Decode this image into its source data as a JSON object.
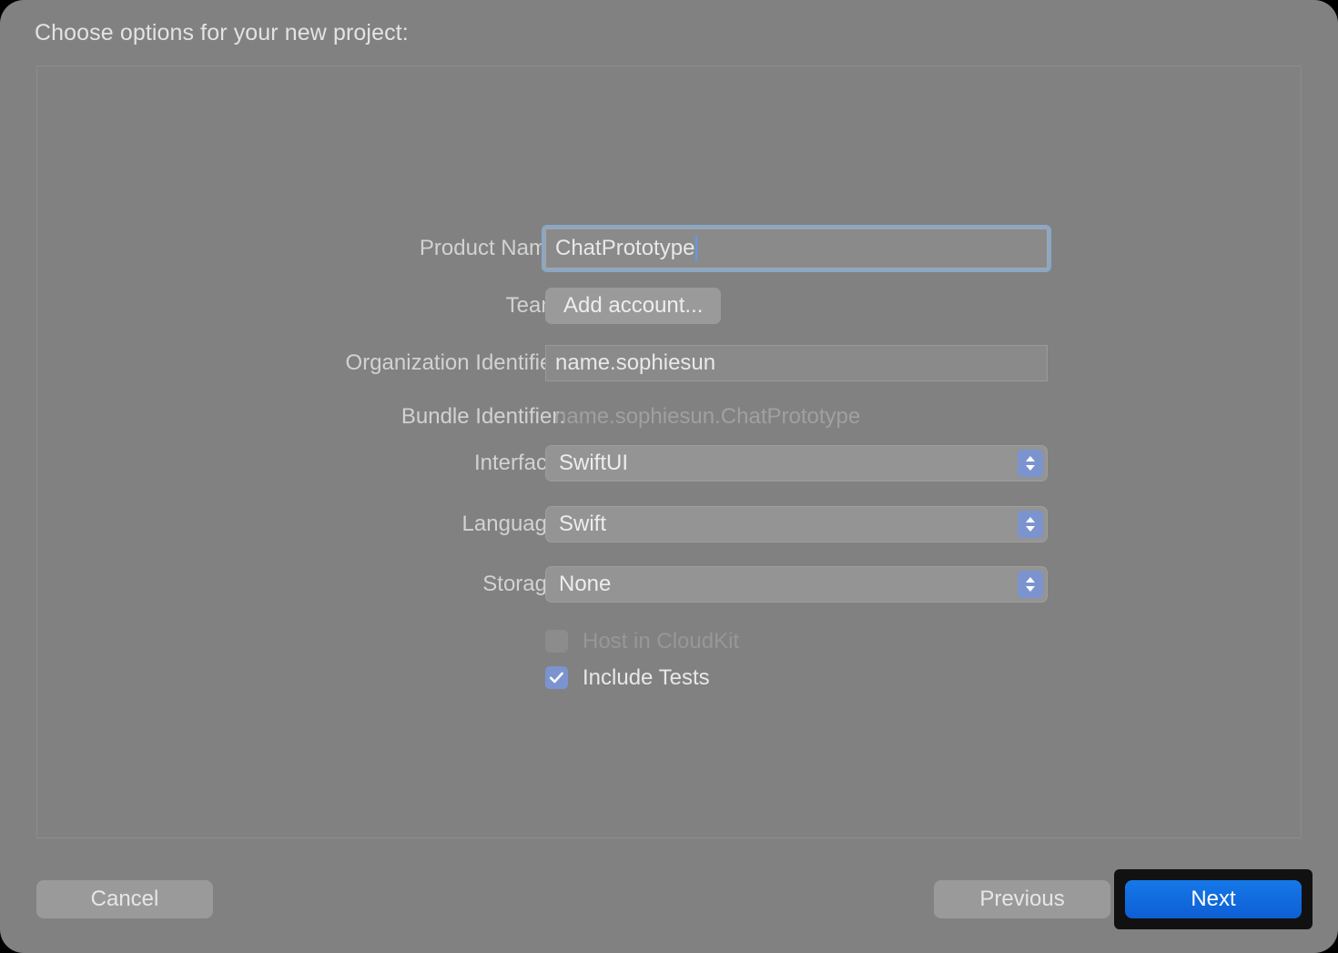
{
  "dialog": {
    "title": "Choose options for your new project:"
  },
  "form": {
    "fields": [
      {
        "label": "Product Name:",
        "value": "ChatPrototype"
      },
      {
        "label": "Team:",
        "value": "Add account..."
      },
      {
        "label": "Organization Identifier:",
        "value": "name.sophiesun"
      },
      {
        "label": "Bundle Identifier:",
        "value": "name.sophiesun.ChatPrototype"
      },
      {
        "label": "Interface:",
        "value": "SwiftUI"
      },
      {
        "label": "Language:",
        "value": "Swift"
      },
      {
        "label": "Storage:",
        "value": "None"
      }
    ],
    "checkboxes": [
      {
        "label": "Host in CloudKit",
        "checked": false,
        "enabled": false
      },
      {
        "label": "Include Tests",
        "checked": true,
        "enabled": true
      }
    ]
  },
  "buttons": {
    "cancel": "Cancel",
    "previous": "Previous",
    "next": "Next"
  },
  "colors": {
    "window_background": "#818181",
    "accent_blue": "#7b94cf",
    "primary_button": "#1268e0",
    "focus_ring": "#8ba7c4",
    "caret": "#5d9bf0",
    "highlight_box": "#111111"
  }
}
